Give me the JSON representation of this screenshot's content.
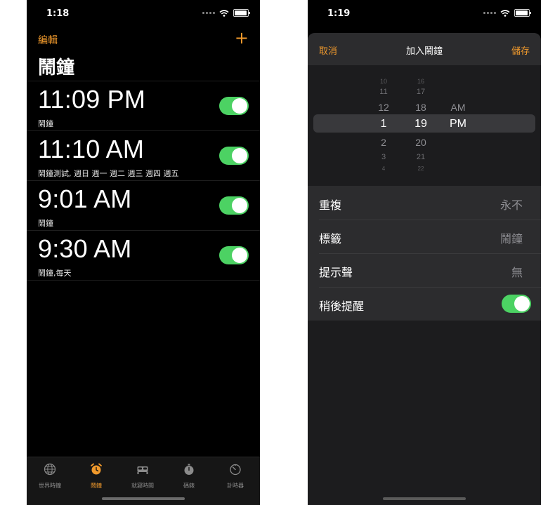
{
  "left": {
    "status_time": "1:18",
    "edit_label": "編輯",
    "add_label": "+",
    "title": "鬧鐘",
    "alarms": [
      {
        "time": "11:09 PM",
        "label": "鬧鐘",
        "enabled": true
      },
      {
        "time": "11:10 AM",
        "label": "鬧鐘測試, 週日 週一 週二 週三 週四 週五",
        "enabled": true
      },
      {
        "time": "9:01 AM",
        "label": "鬧鐘",
        "enabled": true
      },
      {
        "time": "9:30 AM",
        "label": "鬧鐘,每天",
        "enabled": true
      }
    ],
    "tabs": [
      {
        "label": "世界時鐘",
        "icon": "globe-icon",
        "active": false
      },
      {
        "label": "鬧鐘",
        "icon": "alarm-clock-icon",
        "active": true
      },
      {
        "label": "就寢時間",
        "icon": "bed-icon",
        "active": false
      },
      {
        "label": "碼錶",
        "icon": "stopwatch-icon",
        "active": false
      },
      {
        "label": "計時器",
        "icon": "timer-icon",
        "active": false
      }
    ]
  },
  "right": {
    "status_time": "1:19",
    "cancel_label": "取消",
    "title": "加入鬧鐘",
    "save_label": "儲存",
    "picker": {
      "hours": [
        "10",
        "11",
        "12",
        "1",
        "2",
        "3",
        "4"
      ],
      "minutes": [
        "16",
        "17",
        "18",
        "19",
        "20",
        "21",
        "22"
      ],
      "periods": [
        "AM",
        "PM"
      ],
      "selected_hour": "1",
      "selected_minute": "19",
      "selected_period": "PM"
    },
    "settings": [
      {
        "label": "重複",
        "value": "永不"
      },
      {
        "label": "標籤",
        "value": "鬧鐘"
      },
      {
        "label": "提示聲",
        "value": "無"
      },
      {
        "label": "稍後提醒",
        "toggle": true
      }
    ]
  },
  "colors": {
    "accent": "#f19a2c",
    "toggle_on": "#4cd263"
  }
}
